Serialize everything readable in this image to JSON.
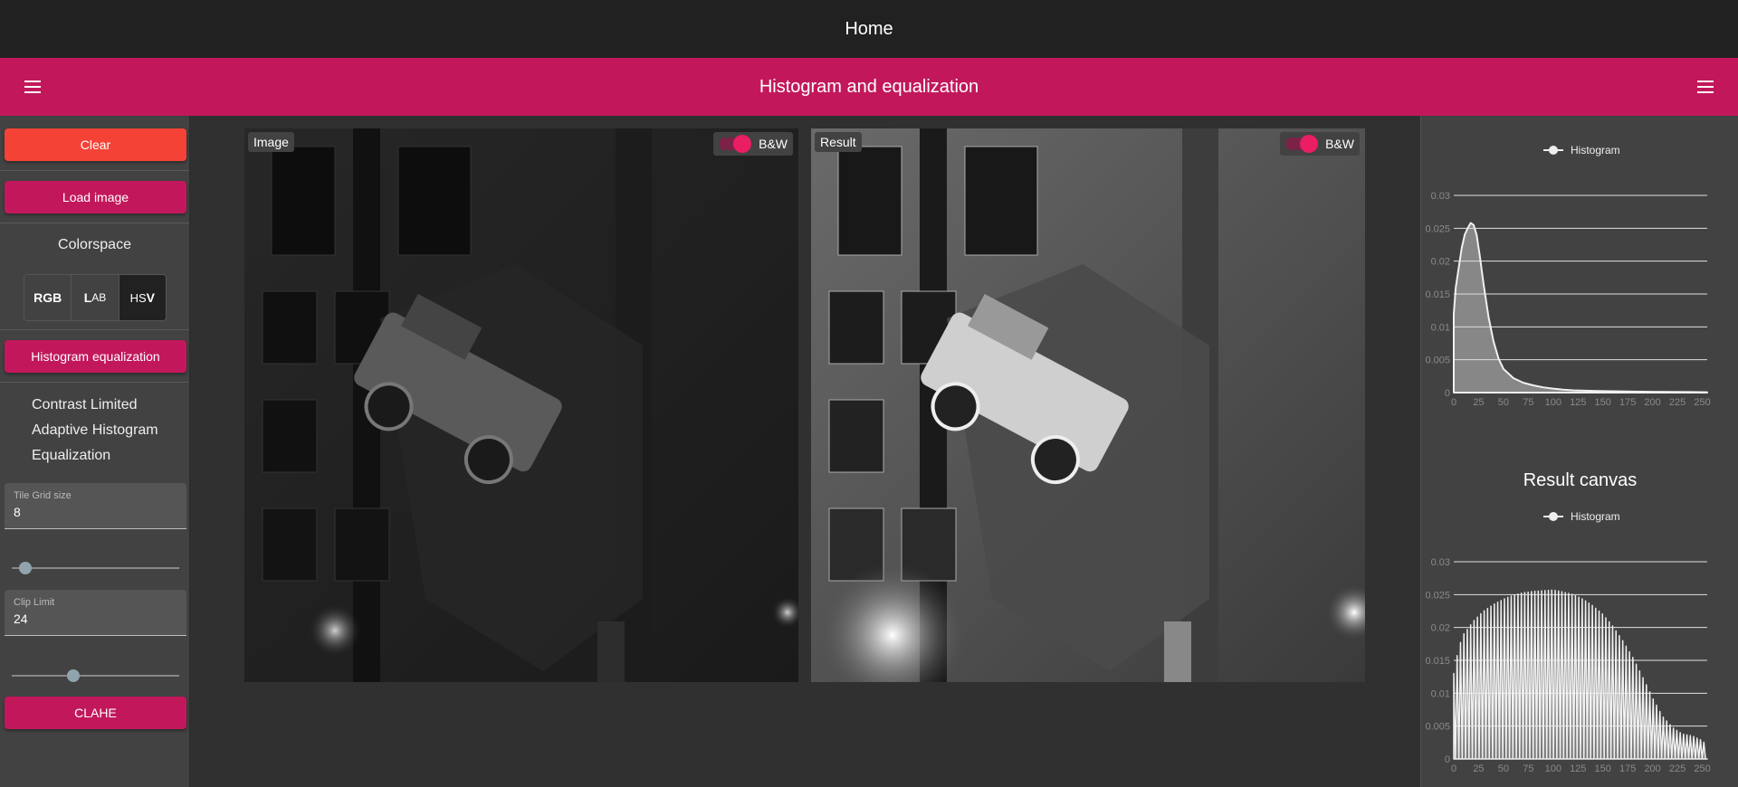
{
  "topbar": {
    "title": "Home"
  },
  "appbar": {
    "title": "Histogram and equalization"
  },
  "sidebar": {
    "clear_label": "Clear",
    "load_label": "Load image",
    "colorspace_label": "Colorspace",
    "colorspaces": [
      {
        "bold": "RGB",
        "rest": ""
      },
      {
        "bold": "L",
        "rest": "AB"
      },
      {
        "pre": "HS",
        "bold": "V"
      }
    ],
    "selected_colorspace": "HSV",
    "hist_eq_label": "Histogram equalization",
    "clahe_desc": "Contrast Limited Adaptive Histogram Equalization",
    "tile_grid_label": "Tile Grid size",
    "tile_grid_value": "8",
    "clip_limit_label": "Clip Limit",
    "clip_limit_value": "24",
    "clahe_label": "CLAHE",
    "tile_slider_fraction": 0.08,
    "clip_slider_fraction": 0.37
  },
  "canvases": {
    "image_label": "Image",
    "result_label": "Result",
    "bw_label": "B&W"
  },
  "right_panel": {
    "result_canvas_title": "Result canvas"
  },
  "chart_data": [
    {
      "type": "area",
      "legend": "Histogram",
      "x_ticks": [
        0,
        25,
        50,
        75,
        100,
        125,
        150,
        175,
        200,
        225,
        250
      ],
      "y_ticks": [
        0,
        0.005,
        0.01,
        0.015,
        0.02,
        0.025,
        0.03
      ],
      "y_tick_labels": [
        "0",
        "0.005",
        "0.01",
        "0.015",
        "0.02",
        "0.025",
        "0.03"
      ],
      "xlim": [
        0,
        255
      ],
      "ylim": [
        0,
        0.03
      ],
      "x": [
        0,
        2,
        5,
        8,
        11,
        14,
        17,
        20,
        23,
        26,
        30,
        35,
        40,
        45,
        50,
        60,
        70,
        80,
        90,
        100,
        110,
        120,
        140,
        160,
        180,
        200,
        220,
        240,
        255
      ],
      "y": [
        0.012,
        0.016,
        0.019,
        0.022,
        0.024,
        0.025,
        0.0258,
        0.0255,
        0.024,
        0.021,
        0.0165,
        0.0115,
        0.0078,
        0.0052,
        0.0036,
        0.0022,
        0.0015,
        0.0011,
        0.0008,
        0.0006,
        0.00045,
        0.00035,
        0.00025,
        0.0002,
        0.00015,
        0.00012,
        0.0001,
        8e-05,
        5e-05
      ]
    },
    {
      "type": "area",
      "legend": "Histogram",
      "x_ticks": [
        0,
        25,
        50,
        75,
        100,
        125,
        150,
        175,
        200,
        225,
        250
      ],
      "y_ticks": [
        0,
        0.005,
        0.01,
        0.015,
        0.02,
        0.025,
        0.03
      ],
      "y_tick_labels": [
        "0",
        "0.005",
        "0.01",
        "0.015",
        "0.02",
        "0.025",
        "0.03"
      ],
      "xlim": [
        0,
        255
      ],
      "ylim": [
        0,
        0.03
      ],
      "note_shape": "comb",
      "envelope_x": [
        0,
        5,
        10,
        20,
        30,
        40,
        50,
        60,
        70,
        80,
        90,
        100,
        110,
        120,
        130,
        140,
        150,
        160,
        170,
        180,
        190,
        200,
        210,
        220,
        230,
        240,
        250,
        255
      ],
      "envelope_y": [
        0.013,
        0.017,
        0.019,
        0.021,
        0.0225,
        0.0235,
        0.0243,
        0.0249,
        0.0253,
        0.0255,
        0.0256,
        0.0257,
        0.0254,
        0.025,
        0.0243,
        0.0233,
        0.022,
        0.0202,
        0.018,
        0.0155,
        0.0125,
        0.0093,
        0.0065,
        0.0048,
        0.0038,
        0.0035,
        0.0028,
        0.002
      ]
    }
  ]
}
